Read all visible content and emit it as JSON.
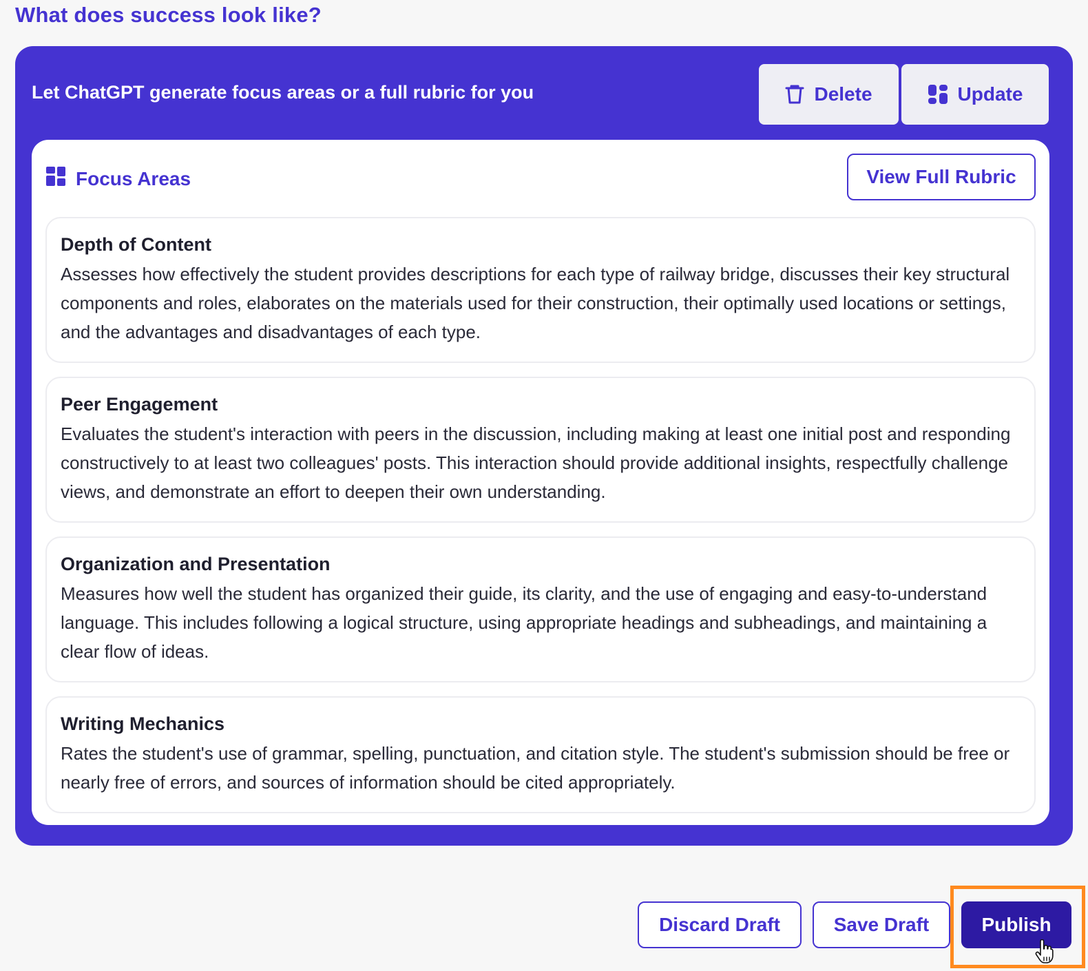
{
  "section_title": "What does success look like?",
  "panel": {
    "header_text": "Let ChatGPT generate focus areas or a full rubric for you",
    "delete_label": "Delete",
    "update_label": "Update"
  },
  "focus": {
    "heading": "Focus Areas",
    "view_rubric_label": "View Full Rubric",
    "items": [
      {
        "title": "Depth of Content",
        "description": "Assesses how effectively the student provides descriptions for each type of railway bridge, discusses their key structural components and roles, elaborates on the materials used for their construction, their optimally used locations or settings, and the advantages and disadvantages of each type."
      },
      {
        "title": "Peer Engagement",
        "description": "Evaluates the student's interaction with peers in the discussion, including making at least one initial post and responding constructively to at least two colleagues' posts. This interaction should provide additional insights, respectfully challenge views, and demonstrate an effort to deepen their own understanding."
      },
      {
        "title": "Organization and Presentation",
        "description": "Measures how well the student has organized their guide, its clarity, and the use of engaging and easy-to-understand language. This includes following a logical structure, using appropriate headings and subheadings, and maintaining a clear flow of ideas."
      },
      {
        "title": "Writing Mechanics",
        "description": "Rates the student's use of grammar, spelling, punctuation, and citation style. The student's submission should be free or nearly free of errors, and sources of information should be cited appropriately."
      }
    ]
  },
  "footer": {
    "discard_label": "Discard Draft",
    "save_label": "Save Draft",
    "publish_label": "Publish"
  },
  "colors": {
    "accent": "#4533d1",
    "publish_bg": "#2d1aa3",
    "highlight": "#ff8a1f"
  },
  "icons": {
    "delete": "trash-icon",
    "update": "layout-icon",
    "focus": "grid-icon",
    "cursor": "hand-pointer-icon"
  }
}
